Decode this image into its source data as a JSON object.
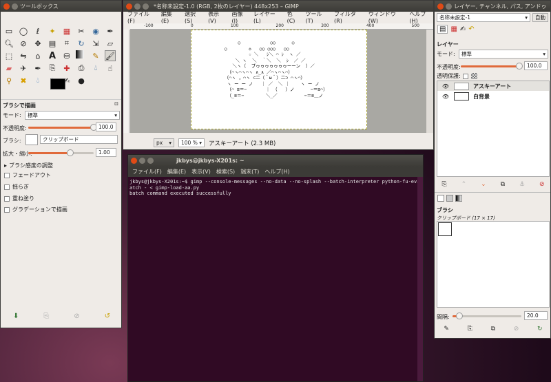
{
  "toolbox": {
    "title": "ツールボックス",
    "section": "ブラシで描画",
    "mode_label": "モード:",
    "mode_value": "標準",
    "opacity_label": "不透明度:",
    "opacity_value": "100.0",
    "opacity_level": 1.0,
    "brush_label": "ブラシ:",
    "brush_value": "クリップボード",
    "scale_label": "拡大・縮小:",
    "scale_value": "1.00",
    "sensitivity": "ブラシ感度の調整",
    "options": [
      "フェードアウト",
      "揺らぎ",
      "重ね塗り",
      "グラデーションで描画"
    ]
  },
  "image_window": {
    "title": "*名称未設定-1.0 (RGB, 2枚のレイヤー) 448x253 – GIMP",
    "menu": [
      "ファイル(F)",
      "編集(E)",
      "選択(S)",
      "表示(V)",
      "画像(I)",
      "レイヤー(L)",
      "色(C)",
      "ツール(T)",
      "フィルタ(R)",
      "ウィンドウ(W)",
      "ヘルプ(H)"
    ],
    "ruler_ticks": [
      "-100",
      "0",
      "100",
      "200",
      "300",
      "400",
      "500"
    ],
    "unit": "px",
    "zoom": "100 %",
    "status": "アスキーアート (2.3 MB)",
    "ascii_art": [
      "        ○           ○○      ○",
      "   ○        ◇   ○○ ○○○   ○○",
      "            ☆ ＼   ｼ＼ ⌒ ｼ  ヽ ／",
      "       ＼ ヽ  ＼  ｀＼  ＼  ｼ  ／ ／",
      "      ＼ヽ（  ブゥゥゥゥゥゥゥーーン  ）／",
      "    （⌒ヽ⌒ヽ⌒ヽ ∧_∧ ／⌒ヽ⌒ヽ⌒）",
      "   （⌒ヽ ，⌒ヽ ⊂二（＾ω＾）二⊃ ⌒ヽ⌒）",
      "    ヽ ー ー ノ   ｜ ／  ＼ ｜    ヽ ー ノ",
      "    （⌒ ≡＝−       ｜ （   ）ノ      −＝≡⌒）",
      "    （_≡＝−        ＼_／          −＝≡＿ノ"
    ]
  },
  "terminal": {
    "title": "jkbys@jkbys-X201s: ~",
    "menu": [
      "ファイル(F)",
      "編集(E)",
      "表示(V)",
      "検索(S)",
      "端末(T)",
      "ヘルプ(H)"
    ],
    "lines": [
      "jkbys@jkbys-X201s:~$ gimp --console-messages --no-data --no-splash --batch-interpreter python-fu-eval --b",
      "atch - < gimp-load-aa.py",
      "batch command executed successfully"
    ]
  },
  "layers": {
    "title": "レイヤー, チャンネル, パス, アンドゥ",
    "image_select": "名称未設定-1",
    "auto_label": "自動",
    "tab_label": "レイヤー",
    "mode_label": "モード:",
    "mode_value": "標準",
    "opacity_label": "不透明度:",
    "opacity_value": "100.0",
    "opacity_level": 1.0,
    "lock_label": "透明保護:",
    "items": [
      {
        "name": "アスキーアート"
      },
      {
        "name": "白背景"
      }
    ],
    "brush_section": "ブラシ",
    "brush_name": "クリップボード (17 × 17)",
    "spacing_label": "間隔:",
    "spacing_value": "20.0",
    "spacing_level": 0.2
  }
}
